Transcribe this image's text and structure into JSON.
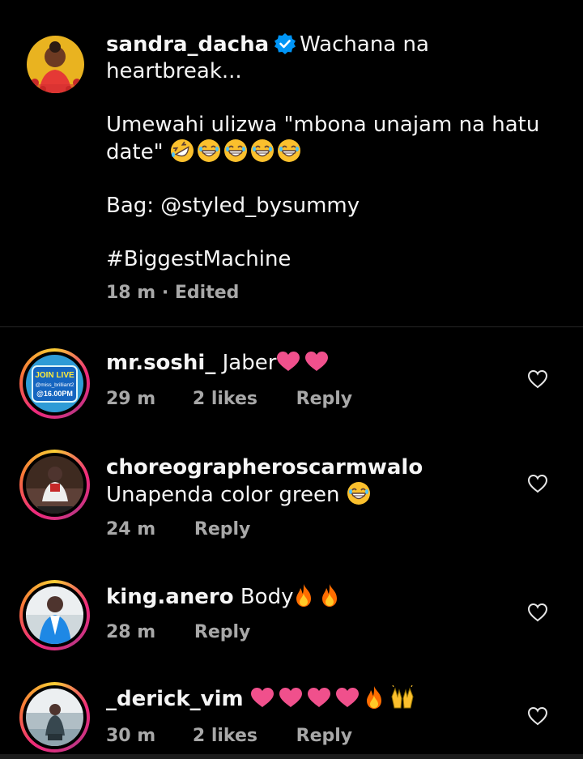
{
  "post": {
    "username": "sandra_dacha",
    "caption_title": "Wachana na heartbreak...",
    "caption_line2": "Umewahi ulizwa \"mbona unajam na hatu date\"",
    "caption_line3": "Bag: @styled_bysummy",
    "caption_line4": "#BiggestMachine",
    "time": "18 m",
    "separator": "·",
    "edited": "Edited"
  },
  "comments": [
    {
      "username": "mr.soshi_",
      "text": "Jaber",
      "time": "29 m",
      "likes": "2 likes",
      "reply": "Reply",
      "avatar_text": [
        "JOIN LIVE",
        "@miss_brilliant2",
        "@16.00PM"
      ]
    },
    {
      "username": "choreographeroscarmwalo",
      "text": "Unapenda color green",
      "time": "24 m",
      "reply": "Reply"
    },
    {
      "username": "king.anero",
      "text": "Body",
      "time": "28 m",
      "reply": "Reply"
    },
    {
      "username": "_derick_vim",
      "text": "",
      "time": "30 m",
      "likes": "2 likes",
      "reply": "Reply"
    }
  ],
  "colors": {
    "background": "#000000",
    "text": "#f5f5f5",
    "secondary_text": "#a8a8a8",
    "verified_badge": "#0095f6",
    "divider": "#262626"
  },
  "icons": {
    "verified": "verified-badge-icon",
    "like": "heart-outline-icon"
  }
}
